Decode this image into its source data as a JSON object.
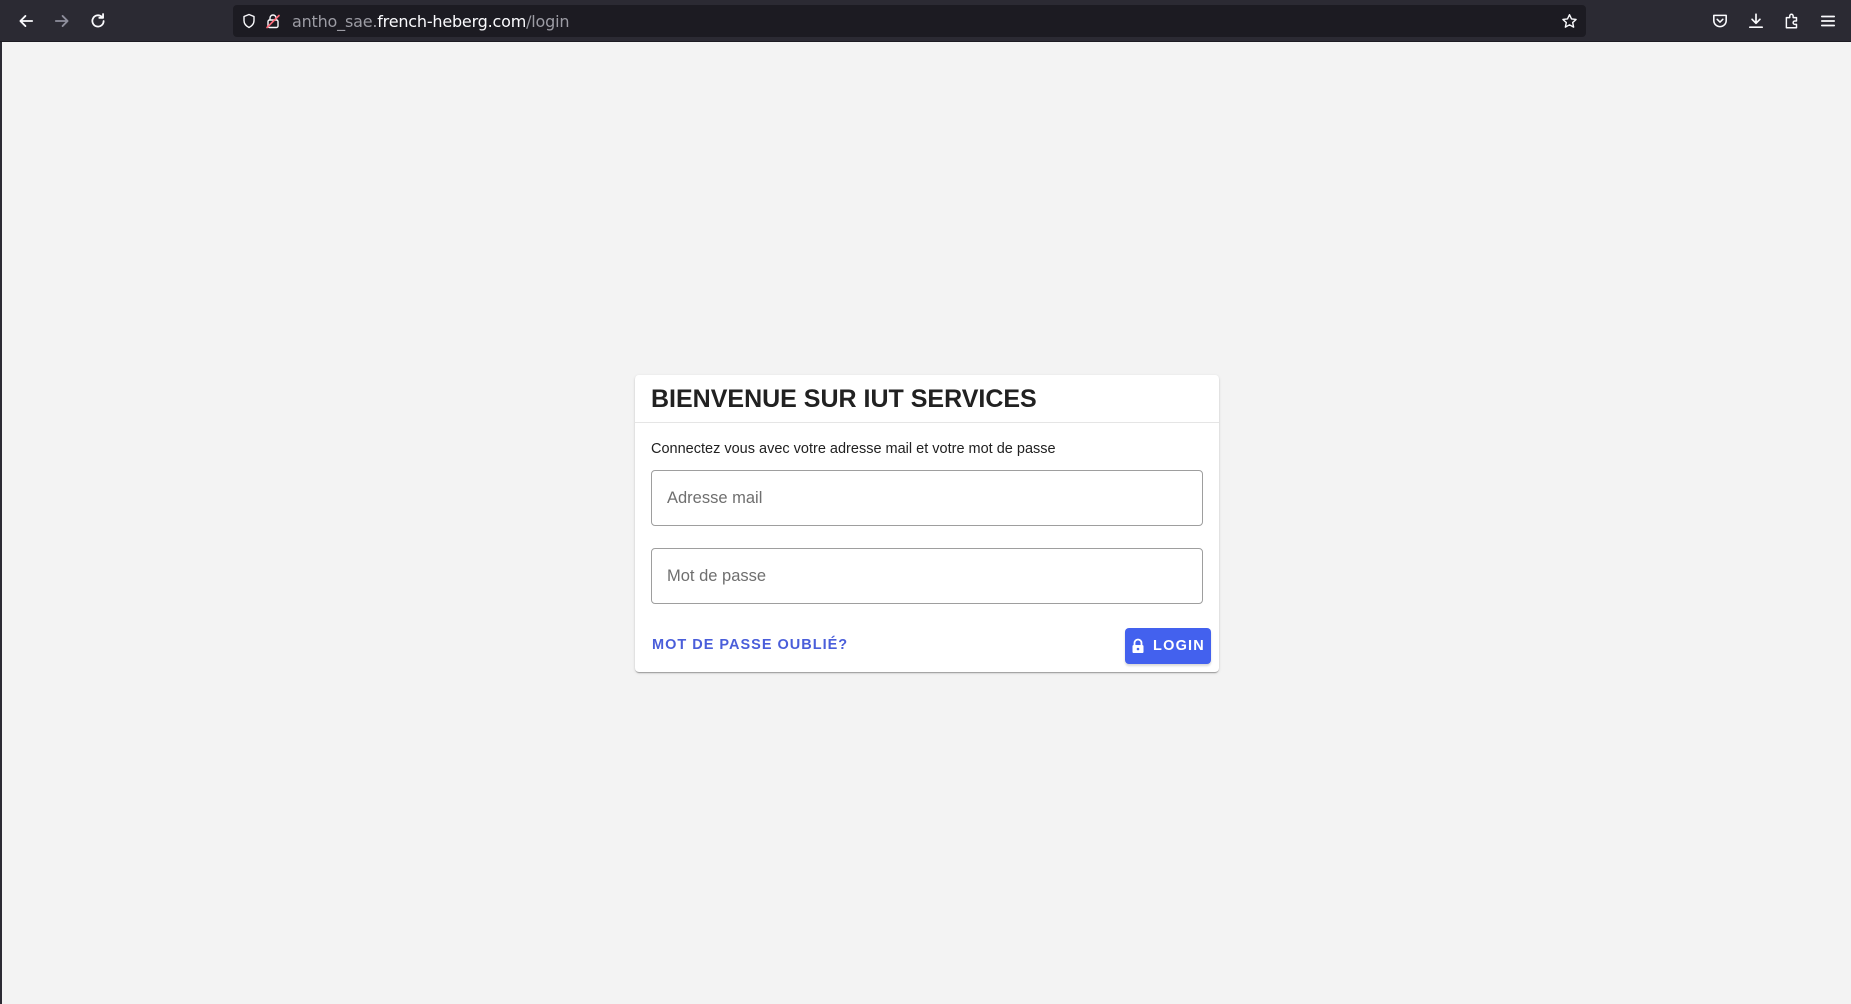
{
  "browser": {
    "url_prefix": "antho_sae.",
    "url_domain": "french-heberg.com",
    "url_path": "/login"
  },
  "login": {
    "title": "BIENVENUE SUR IUT SERVICES",
    "subtitle": "Connectez vous avec votre adresse mail et votre mot de passe",
    "email_placeholder": "Adresse mail",
    "email_value": "",
    "password_placeholder": "Mot de passe",
    "password_value": "",
    "forgot_label": "MOT DE PASSE OUBLIÉ?",
    "login_label": "LOGIN"
  },
  "colors": {
    "accent": "#4361ee",
    "link": "#4a5eda",
    "page_bg": "#f3f3f3",
    "toolbar_bg": "#2b2a33"
  },
  "icons": {
    "toolbar": [
      "back-arrow-icon",
      "forward-arrow-icon",
      "reload-icon",
      "bookmark-star-icon",
      "pocket-icon",
      "download-icon",
      "extensions-icon",
      "menu-icon"
    ],
    "urlbar": [
      "tracking-protection-shield-icon",
      "insecure-lock-icon"
    ],
    "login_button": "lock-icon"
  }
}
